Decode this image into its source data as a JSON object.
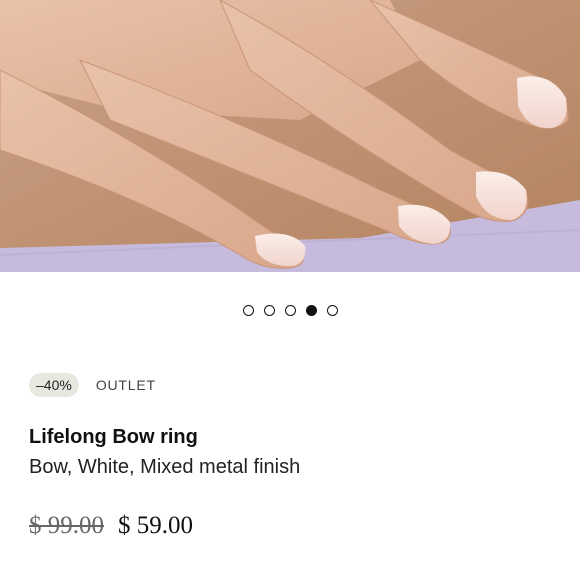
{
  "gallery": {
    "image_alt": "Hands with nude manicure",
    "dots": [
      {
        "active": false
      },
      {
        "active": false
      },
      {
        "active": false
      },
      {
        "active": true
      },
      {
        "active": false
      }
    ]
  },
  "product": {
    "discount_badge": "–40%",
    "tag": "OUTLET",
    "title": "Lifelong Bow ring",
    "subtitle": "Bow, White, Mixed metal finish",
    "original_price": "$ 99.00",
    "sale_price": "$ 59.00"
  },
  "colors": {
    "skin": "#e1b297",
    "lavender": "#c4b9db",
    "badge_bg": "#e7e8df"
  }
}
